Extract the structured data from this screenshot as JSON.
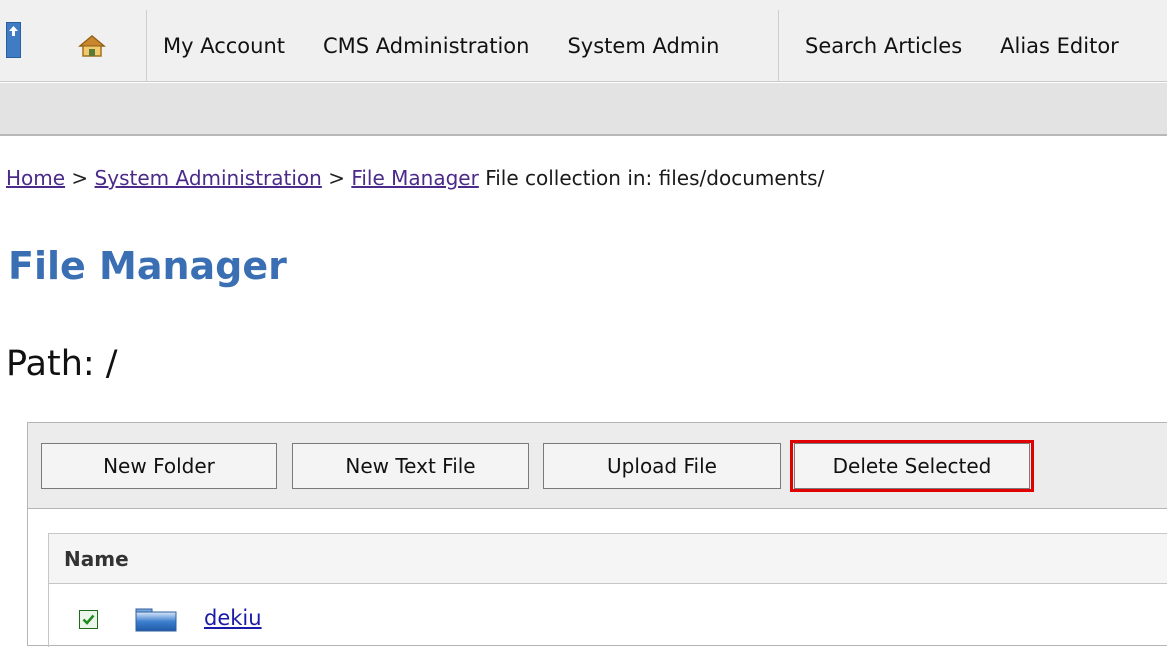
{
  "nav": {
    "group1": [
      "My Account",
      "CMS Administration",
      "System Admin"
    ],
    "group2": [
      "Search Articles",
      "Alias Editor"
    ]
  },
  "breadcrumb": {
    "home": "Home",
    "sep": ">",
    "system_admin": "System Administration",
    "file_manager": "File Manager",
    "trail_text": "File collection in: files/documents/"
  },
  "page_title": "File Manager",
  "path_label": "Path: /",
  "toolbar": {
    "new_folder": "New Folder",
    "new_text_file": "New Text File",
    "upload_file": "Upload File",
    "delete_selected": "Delete Selected"
  },
  "table": {
    "header_name": "Name",
    "rows": [
      {
        "name": "dekiu",
        "checked": true
      }
    ]
  },
  "colors": {
    "title": "#3a6fb3",
    "highlight": "#e00000",
    "link_visited": "#4b2a8a",
    "link": "#1a1aa8"
  },
  "icons": [
    "collapse-handle-icon",
    "home-icon",
    "checkbox-checked-icon",
    "folder-icon"
  ]
}
